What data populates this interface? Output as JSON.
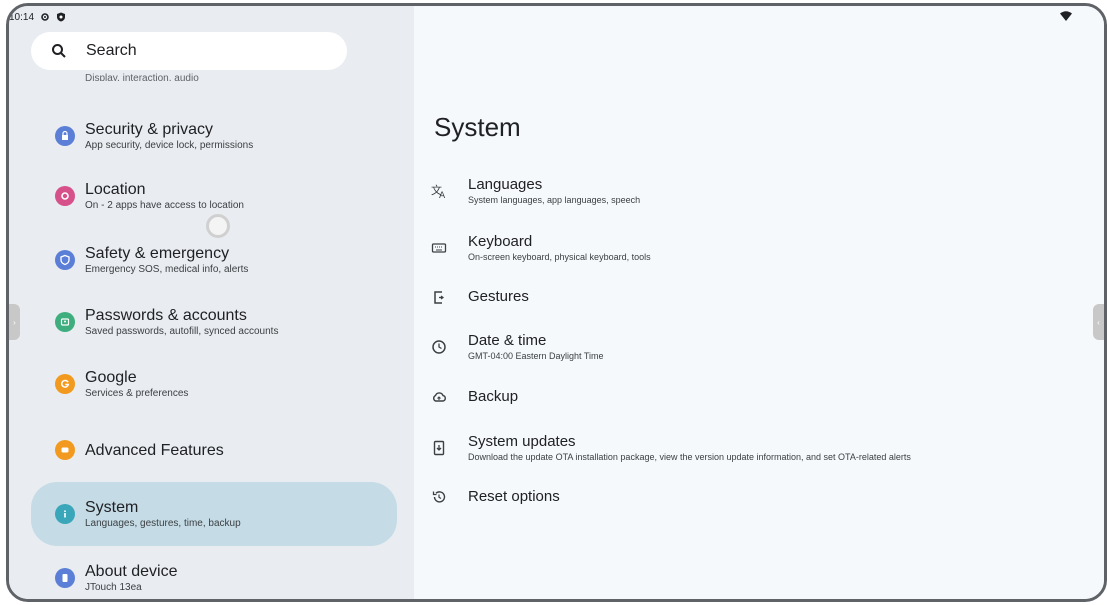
{
  "status_bar": {
    "time": "10:14"
  },
  "search": {
    "label": "Search"
  },
  "cutoff_text": "Display, interaction, audio",
  "sidebar": {
    "items": [
      {
        "title": "Security & privacy",
        "subtitle": "App security, device lock, permissions",
        "icon": "lock-icon",
        "color": "#5b7fd6"
      },
      {
        "title": "Location",
        "subtitle": "On - 2 apps have access to location",
        "icon": "location-pin-icon",
        "color": "#d6508a"
      },
      {
        "title": "Safety & emergency",
        "subtitle": "Emergency SOS, medical info, alerts",
        "icon": "shield-icon",
        "color": "#5b7fd6"
      },
      {
        "title": "Passwords & accounts",
        "subtitle": "Saved passwords, autofill, synced accounts",
        "icon": "account-icon",
        "color": "#3fae7e"
      },
      {
        "title": "Google",
        "subtitle": "Services & preferences",
        "icon": "google-icon",
        "color": "#f29a1f"
      },
      {
        "title": "Advanced Features",
        "subtitle": "",
        "icon": "advanced-features-icon",
        "color": "#f29a1f"
      },
      {
        "title": "System",
        "subtitle": "Languages, gestures, time, backup",
        "icon": "info-icon",
        "color": "#3aa6b9"
      },
      {
        "title": "About device",
        "subtitle": "JTouch 13ea",
        "icon": "device-icon",
        "color": "#5b7fd6"
      }
    ]
  },
  "main": {
    "title": "System",
    "items": [
      {
        "title": "Languages",
        "subtitle": "System languages, app languages, speech",
        "icon": "translate-icon"
      },
      {
        "title": "Keyboard",
        "subtitle": "On-screen keyboard, physical keyboard, tools",
        "icon": "keyboard-icon"
      },
      {
        "title": "Gestures",
        "subtitle": "",
        "icon": "gestures-icon"
      },
      {
        "title": "Date & time",
        "subtitle": "GMT-04:00 Eastern Daylight Time",
        "icon": "clock-icon"
      },
      {
        "title": "Backup",
        "subtitle": "",
        "icon": "cloud-backup-icon"
      },
      {
        "title": "System updates",
        "subtitle": "Download the update OTA installation package, view the version update information, and set OTA-related alerts",
        "icon": "system-update-icon"
      },
      {
        "title": "Reset options",
        "subtitle": "",
        "icon": "reset-icon"
      }
    ]
  }
}
